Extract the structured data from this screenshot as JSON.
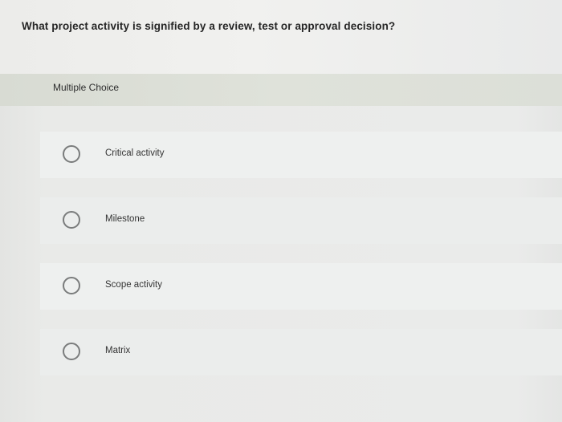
{
  "question": {
    "text": "What project activity is signified by a review, test or approval decision?"
  },
  "choice_section": {
    "header_label": "Multiple Choice"
  },
  "options": [
    {
      "label": "Critical activity",
      "selected": false
    },
    {
      "label": "Milestone",
      "selected": false
    },
    {
      "label": "Scope activity",
      "selected": false
    },
    {
      "label": "Matrix",
      "selected": false
    }
  ]
}
